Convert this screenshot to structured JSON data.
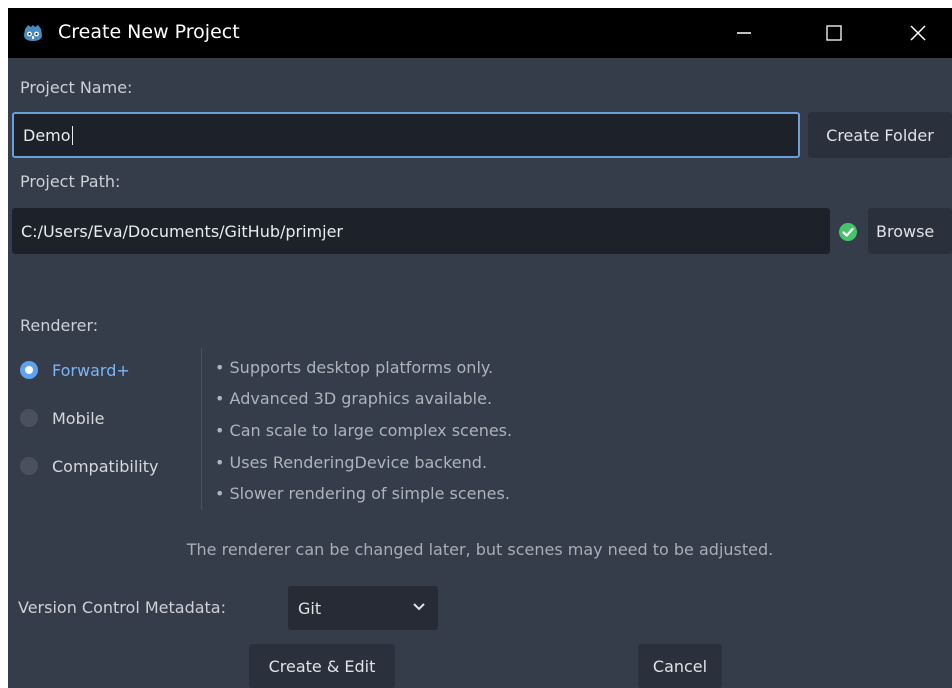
{
  "window": {
    "title": "Create New Project"
  },
  "project_name": {
    "label": "Project Name:",
    "value": "Demo",
    "create_folder_label": "Create Folder"
  },
  "project_path": {
    "label": "Project Path:",
    "value": "C:/Users/Eva/Documents/GitHub/primjer",
    "status_icon": "check-circle-icon",
    "browse_label": "Browse"
  },
  "renderer": {
    "label": "Renderer:",
    "options": [
      {
        "label": "Forward+",
        "selected": true
      },
      {
        "label": "Mobile",
        "selected": false
      },
      {
        "label": "Compatibility",
        "selected": false
      }
    ],
    "features": [
      "• Supports desktop platforms only.",
      "• Advanced 3D graphics available.",
      "• Can scale to large complex scenes.",
      "• Uses RenderingDevice backend.",
      "• Slower rendering of simple scenes."
    ],
    "note": "The renderer can be changed later, but scenes may need to be adjusted."
  },
  "version_control": {
    "label": "Version Control Metadata:",
    "selected": "Git"
  },
  "actions": {
    "create_edit_label": "Create & Edit",
    "cancel_label": "Cancel"
  },
  "colors": {
    "accent": "#6aa0da",
    "selected_text": "#7cb6f2",
    "success": "#45c46a",
    "background": "#363d4a"
  }
}
